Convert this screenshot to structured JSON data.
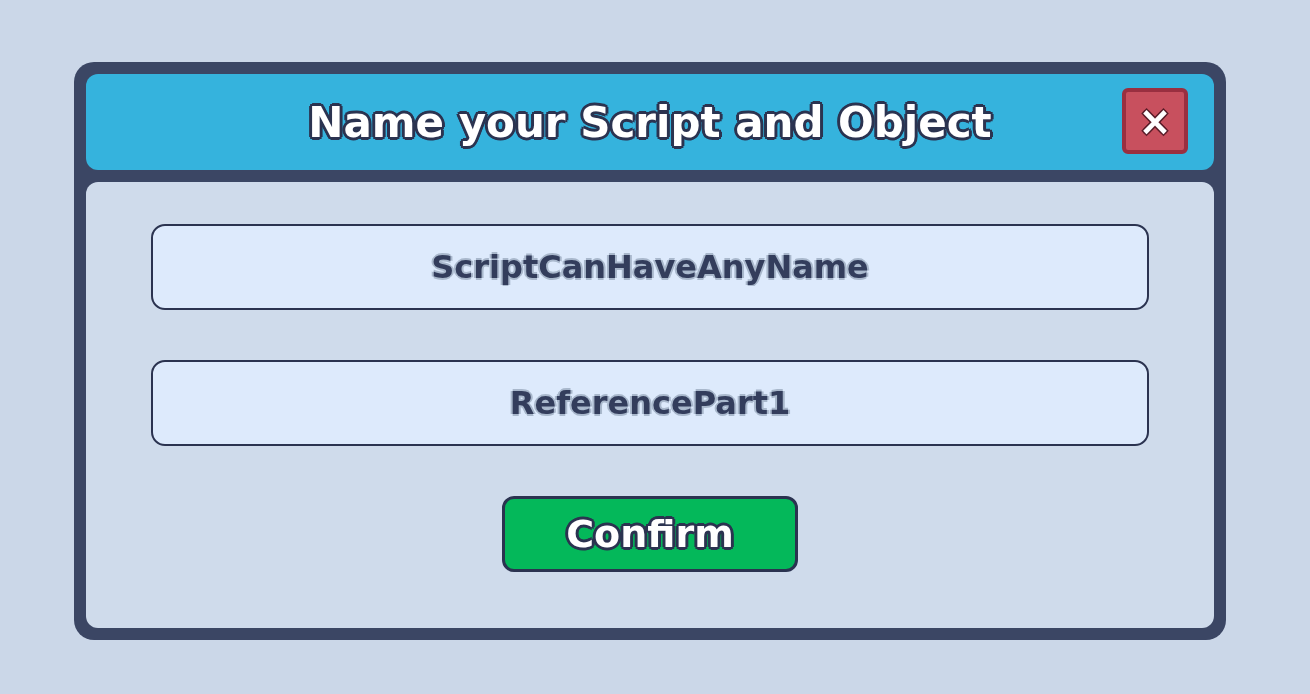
{
  "dialog": {
    "title": "Name your Script and Object",
    "close": "×"
  },
  "fields": [
    {
      "value": "ScriptCanHaveAnyName"
    },
    {
      "value": "ReferencePart1"
    }
  ],
  "confirm_button": "Confirm"
}
